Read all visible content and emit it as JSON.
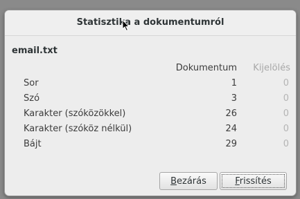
{
  "window": {
    "title": "Statisztika a dokumentumról"
  },
  "file": {
    "name": "email.txt"
  },
  "columns": {
    "document": "Dokumentum",
    "selection": "Kijelölés"
  },
  "rows": [
    {
      "label": "Sor",
      "document": "1",
      "selection": "0"
    },
    {
      "label": "Szó",
      "document": "3",
      "selection": "0"
    },
    {
      "label": "Karakter (szóközökkel)",
      "document": "26",
      "selection": "0"
    },
    {
      "label": "Karakter (szóköz nélkül)",
      "document": "24",
      "selection": "0"
    },
    {
      "label": "Bájt",
      "document": "29",
      "selection": "0"
    }
  ],
  "buttons": {
    "close": {
      "mnemonic": "B",
      "rest": "ezárás"
    },
    "refresh": {
      "mnemonic": "F",
      "rest": "rissítés"
    }
  },
  "icons": {
    "pointer": "mouse-pointer-icon"
  }
}
